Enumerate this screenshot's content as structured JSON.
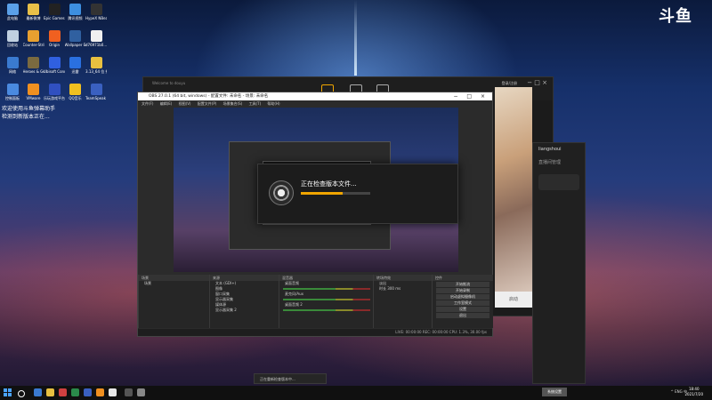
{
  "desktop": {
    "brand_logo": "斗鱼",
    "icons": [
      {
        "label": "此电脑",
        "color": "#5aa0e8"
      },
      {
        "label": "最新微博",
        "color": "#e8c048"
      },
      {
        "label": "Epic Games Launcher",
        "color": "#222222"
      },
      {
        "label": "腾讯视频",
        "color": "#3d8fe0"
      },
      {
        "label": "HypeX NBeauty",
        "color": "#333333"
      },
      {
        "label": "回收站",
        "color": "#c0d0e0"
      },
      {
        "label": "Counter-Strike Global Off...",
        "color": "#e8a030"
      },
      {
        "label": "Origin",
        "color": "#f06020"
      },
      {
        "label": "Wallpaper Engine",
        "color": "#3060a0"
      },
      {
        "label": "d76971b0...",
        "color": "#f0f0f0"
      },
      {
        "label": "网络",
        "color": "#3a7ad0"
      },
      {
        "label": "Heroes & Generals",
        "color": "#7a6a40"
      },
      {
        "label": "Ubisoft Connect",
        "color": "#3060e0"
      },
      {
        "label": "迅雷",
        "color": "#2a70e0"
      },
      {
        "label": "3.13_64 位 播放版",
        "color": "#e8c040"
      },
      {
        "label": "控制面板",
        "color": "#4a8ae0"
      },
      {
        "label": "VMware",
        "color": "#f09020"
      },
      {
        "label": "乐玩游戏平台",
        "color": "#3050c0"
      },
      {
        "label": "QQ音乐",
        "color": "#f0c020"
      },
      {
        "label": "TeamSpeak 3",
        "color": "#3a60c0"
      }
    ],
    "notification": "欢迎使用斗鱼弹幕助手\n检测到新版本正在..."
  },
  "douyu_window": {
    "title": "Welcome to douyu",
    "user": "登录/注册",
    "banner_button": "启动"
  },
  "side_panel": {
    "title": "liangshoui",
    "subtitle": "直播间管理"
  },
  "obs": {
    "title": "OBS 27.0.1 (64 bit, windows) - 配置文件: 未命名 - 场景: 未命名",
    "menu": [
      "文件(F)",
      "编辑(E)",
      "视图(V)",
      "配置文件(P)",
      "场景集合(S)",
      "工具(T)",
      "帮助(H)"
    ],
    "dialog_text": "正在检查版本文件...",
    "progress": 0.6,
    "docks": {
      "scenes_header": "场景",
      "sources_header": "来源",
      "mixer_header": "混音器",
      "transitions_header": "转场特效",
      "controls_header": "控件",
      "scenes": [
        "场景"
      ],
      "sources": [
        "文本 (GDI+)",
        "图像",
        "窗口采集",
        "显示器采集",
        "媒体源",
        "显示器采集 2"
      ],
      "mixer_tracks": [
        "桌面音频",
        "麦克风/Aux",
        "桌面音频 2"
      ],
      "transition_value": "淡出",
      "duration_label": "时长",
      "duration_value": "300 ms",
      "control_buttons": [
        "开始推流",
        "开始录制",
        "启动虚拟摄像机",
        "工作室模式",
        "设置",
        "退出"
      ]
    },
    "status": "LIVE: 00:00:00   REC: 00:00:00   CPU: 1.3%, 30.00 fps"
  },
  "toast": "正在重新检查版本中...",
  "taskbar": {
    "notice_button": "系统设置",
    "tray": "^ ENG 中",
    "time": "18:40",
    "date": "2021/7/20"
  }
}
